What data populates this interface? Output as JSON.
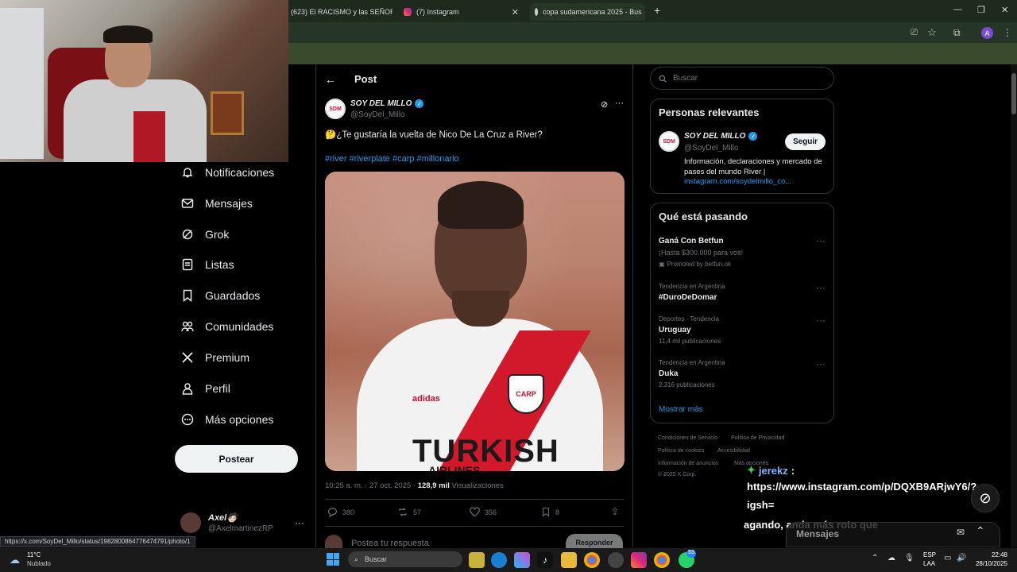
{
  "browser": {
    "tabs": [
      {
        "title": "(623) El RACISMO y las SEÑORA"
      },
      {
        "title": "(7) Instagram"
      },
      {
        "title": "copa sudamericana 2025 - Bus"
      }
    ],
    "profile_letter": "A"
  },
  "nav": {
    "items": [
      {
        "label": "Notificaciones",
        "icon": "bell-icon"
      },
      {
        "label": "Mensajes",
        "icon": "envelope-icon"
      },
      {
        "label": "Grok",
        "icon": "grok-icon"
      },
      {
        "label": "Listas",
        "icon": "list-icon"
      },
      {
        "label": "Guardados",
        "icon": "bookmark-icon"
      },
      {
        "label": "Comunidades",
        "icon": "communities-icon"
      },
      {
        "label": "Premium",
        "icon": "x-logo-icon"
      },
      {
        "label": "Perfil",
        "icon": "person-icon"
      },
      {
        "label": "Más opciones",
        "icon": "more-circle-icon"
      }
    ],
    "post_button": "Postear",
    "account": {
      "name": "Axel🧑🏻",
      "handle": "@AxelmartinezRP"
    }
  },
  "post": {
    "header_title": "Post",
    "author_name": "SOY DEL MILLO",
    "author_handle": "@SoyDel_Millo",
    "text": "🤔¿Te gustaría la vuelta de Nico De La Cruz a River?",
    "hashtags": "#river #riverplate #carp #millonario",
    "image_text": {
      "sponsor": "TURKISH",
      "sponsor2": "AIRLINES",
      "brand": "adidas",
      "crest": "CARP"
    },
    "time": "10:25 a. m. · 27 oct. 2025 · ",
    "views": "128,9 mil",
    "views_label": " Visualizaciones",
    "replies": "380",
    "reposts": "57",
    "likes": "356",
    "bookmarks": "8",
    "reply_placeholder": "Postea tu respuesta",
    "reply_button": "Responder"
  },
  "sidebar": {
    "search_placeholder": "Buscar",
    "relevant_title": "Personas relevantes",
    "relevant_name": "SOY DEL MILLO",
    "relevant_handle": "@SoyDel_Millo",
    "follow": "Seguir",
    "bio": "Información, declaraciones y mercado de pases del mundo River |",
    "bio_link": "instagram.com/soydelmillo_co...",
    "trending_title": "Qué está pasando",
    "trends": [
      {
        "meta": "",
        "name": "Ganá Con Betfun",
        "sub": "¡Hasta $300.000 para vos!",
        "promo": "Promoted by betfun.ok"
      },
      {
        "meta": "Tendencia en Argentina",
        "name": "#DuroDeDomar",
        "sub": "",
        "promo": ""
      },
      {
        "meta": "Deportes · Tendencia",
        "name": "Uruguay",
        "sub": "11,4 mil publicaciones",
        "promo": ""
      },
      {
        "meta": "Tendencia en Argentina",
        "name": "Duka",
        "sub": "2.316 publicaciones",
        "promo": ""
      }
    ],
    "show_more": "Mostrar más",
    "footer": [
      "Condiciones de Servicio",
      "Política de Privacidad",
      "Política de cookies",
      "Accesibilidad",
      "Información de anuncios",
      "Más opciones",
      "© 2025 X Corp."
    ]
  },
  "chat": {
    "user": "jerekz",
    "line1": "https://www.instagram.com/p/DQXB9ARjwY6/?",
    "line2": "igsh=",
    "line3": "agando, anda más roto que"
  },
  "messages_label": "Mensajes",
  "status_url": "https://x.com/SoyDel_Millo/status/1982800864776474791/photo/1",
  "taskbar": {
    "weather_temp": "11°C",
    "weather_text": "Nublado",
    "search": "Buscar",
    "lang1": "ESP",
    "lang2": "LAA",
    "time": "22:48",
    "date": "28/10/2025",
    "badge": "53"
  }
}
